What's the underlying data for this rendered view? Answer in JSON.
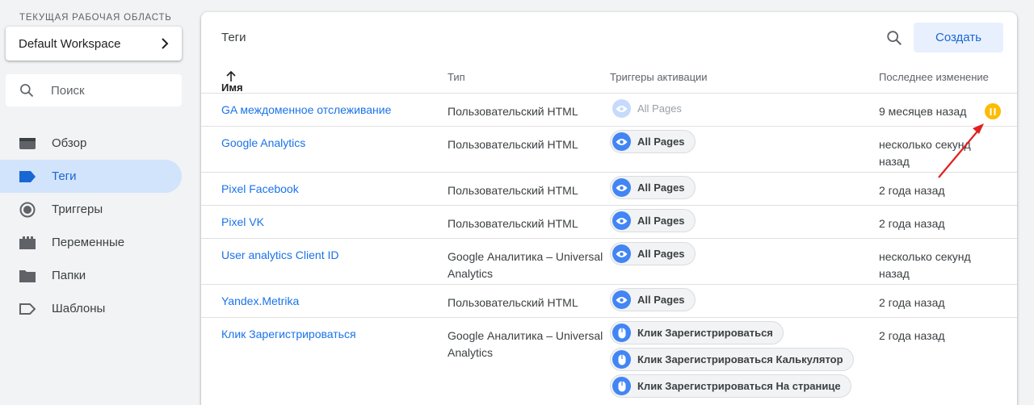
{
  "sidebar": {
    "workspace_label": "Текущая рабочая область",
    "workspace_name": "Default Workspace",
    "search_placeholder": "Поиск",
    "nav": [
      {
        "label": "Обзор",
        "icon": "overview-icon"
      },
      {
        "label": "Теги",
        "icon": "tag-icon",
        "active": true
      },
      {
        "label": "Триггеры",
        "icon": "trigger-icon"
      },
      {
        "label": "Переменные",
        "icon": "variables-icon"
      },
      {
        "label": "Папки",
        "icon": "folder-icon"
      },
      {
        "label": "Шаблоны",
        "icon": "template-icon"
      }
    ]
  },
  "main": {
    "title": "Теги",
    "create_label": "Создать",
    "columns": {
      "name": "Имя",
      "type": "Тип",
      "triggers": "Триггеры активации",
      "modified": "Последнее изменение"
    },
    "rows": [
      {
        "name": "GA междоменное отслеживание",
        "type": "Пользовательский HTML",
        "triggers": [
          {
            "label": "All Pages",
            "kind": "eye",
            "faded": true
          }
        ],
        "modified": "9 месяцев назад",
        "paused": true
      },
      {
        "name": "Google Analytics",
        "type": "Пользовательский HTML",
        "triggers": [
          {
            "label": "All Pages",
            "kind": "eye"
          }
        ],
        "modified": "несколько секунд назад"
      },
      {
        "name": "Pixel Facebook",
        "type": "Пользовательский HTML",
        "triggers": [
          {
            "label": "All Pages",
            "kind": "eye"
          }
        ],
        "modified": "2 года назад"
      },
      {
        "name": "Pixel VK",
        "type": "Пользовательский HTML",
        "triggers": [
          {
            "label": "All Pages",
            "kind": "eye"
          }
        ],
        "modified": "2 года назад"
      },
      {
        "name": "User analytics Client ID",
        "type": "Google Аналитика – Universal Analytics",
        "triggers": [
          {
            "label": "All Pages",
            "kind": "eye"
          }
        ],
        "modified": "несколько секунд назад"
      },
      {
        "name": "Yandex.Metrika",
        "type": "Пользовательский HTML",
        "triggers": [
          {
            "label": "All Pages",
            "kind": "eye"
          }
        ],
        "modified": "2 года назад"
      },
      {
        "name": "Клик Зарегистрироваться",
        "type": "Google Аналитика – Universal Analytics",
        "triggers": [
          {
            "label": "Клик Зарегистрироваться",
            "kind": "click"
          },
          {
            "label": "Клик Зарегистрироваться Калькулятор",
            "kind": "click"
          },
          {
            "label": "Клик Зарегистрироваться На странице",
            "kind": "click"
          }
        ],
        "modified": "2 года назад"
      }
    ]
  },
  "colors": {
    "accent": "#1a73e8",
    "active_nav_bg": "#d2e3fc",
    "pause": "#fbbc04",
    "annotation_arrow": "#e02020"
  }
}
